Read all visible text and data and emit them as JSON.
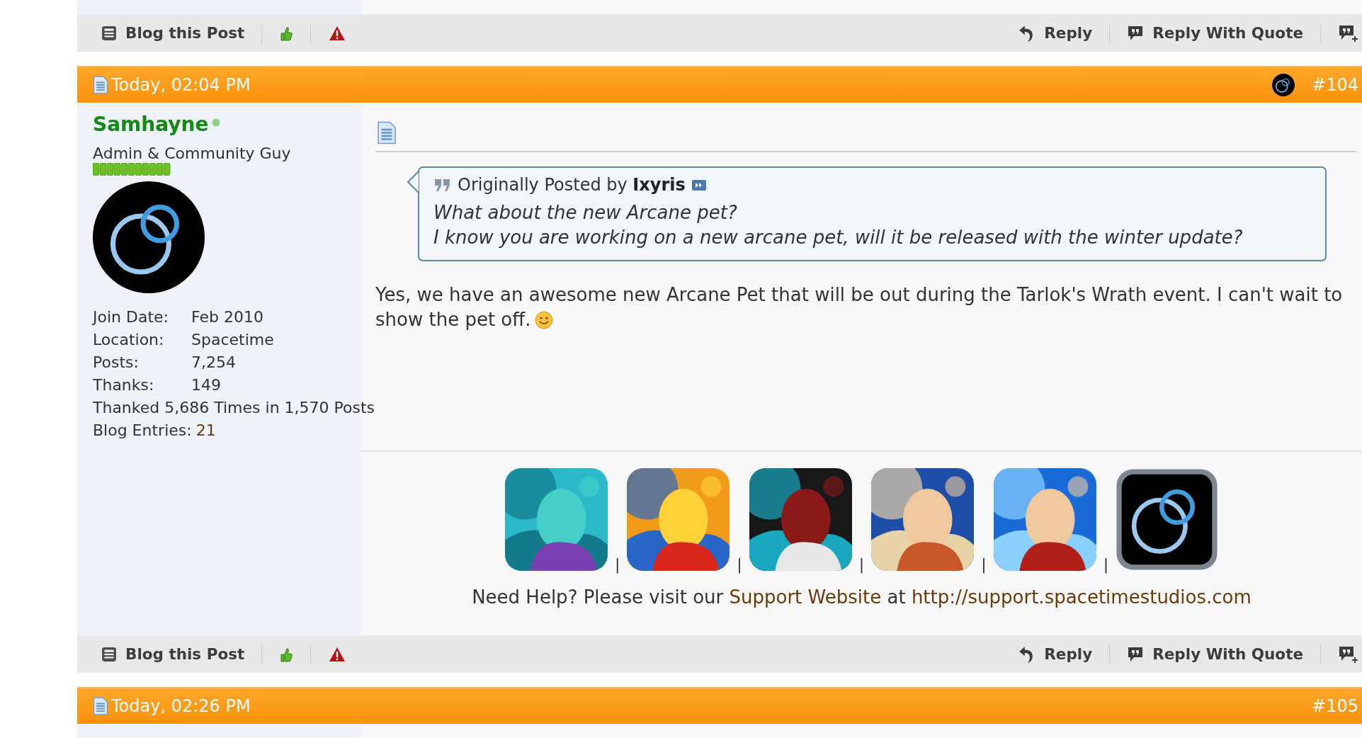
{
  "top_toolbar": {
    "left": [
      {
        "kind": "blog",
        "label": "Blog this Post"
      },
      {
        "kind": "thanks"
      },
      {
        "kind": "report"
      }
    ],
    "right": [
      {
        "kind": "reply",
        "label": "Reply"
      },
      {
        "kind": "quote",
        "label": "Reply With Quote"
      },
      {
        "kind": "multiquote"
      }
    ]
  },
  "post": {
    "date": "Today, 02:04 PM",
    "number": "#104",
    "author": {
      "name": "Samhayne",
      "online": true,
      "title": "Admin & Community Guy",
      "stats": [
        {
          "label": "Join Date:",
          "value": "Feb 2010"
        },
        {
          "label": "Location:",
          "value": "Spacetime"
        },
        {
          "label": "Posts:",
          "value": "7,254"
        },
        {
          "label": "Thanks:",
          "value": "149"
        },
        {
          "label": "Thanked 5,686 Times in 1,570 Posts"
        },
        {
          "label": "Blog Entries:",
          "value": "21",
          "kind": "link"
        }
      ]
    },
    "quote": {
      "attribution": "Originally Posted by **Ixyris**",
      "lines": [
        "What about the new Arcane pet?",
        "I know you are working on a new arcane pet, will it be released with the winter update?"
      ]
    },
    "message_lines": [
      "Yes, we have an awesome new Arcane Pet that will be out during the Tarlok's Wrath event. I can't wait to",
      "show the pet off."
    ],
    "signature": {
      "images": [
        {
          "kind": "picture"
        },
        {
          "kind": "picture"
        },
        {
          "kind": "picture"
        },
        {
          "kind": "picture"
        },
        {
          "kind": "picture"
        },
        {
          "kind": "logo"
        }
      ],
      "separator": "|",
      "help": [
        {
          "kind": "text",
          "text": "Need Help? Please visit our"
        },
        {
          "kind": "link",
          "text": "Support Website"
        },
        {
          "kind": "text",
          "text": "at"
        },
        {
          "kind": "link",
          "text": "http://support.spacetimestudios.com"
        }
      ]
    }
  },
  "bottom_toolbar": {
    "left": [
      {
        "kind": "blog",
        "label": "Blog this Post"
      },
      {
        "kind": "thanks"
      },
      {
        "kind": "report"
      }
    ],
    "right": [
      {
        "kind": "reply",
        "label": "Reply"
      },
      {
        "kind": "quote",
        "label": "Reply With Quote"
      },
      {
        "kind": "multiquote"
      }
    ]
  },
  "next_post": {
    "date": "Today, 02:26 PM",
    "number": "#105"
  }
}
